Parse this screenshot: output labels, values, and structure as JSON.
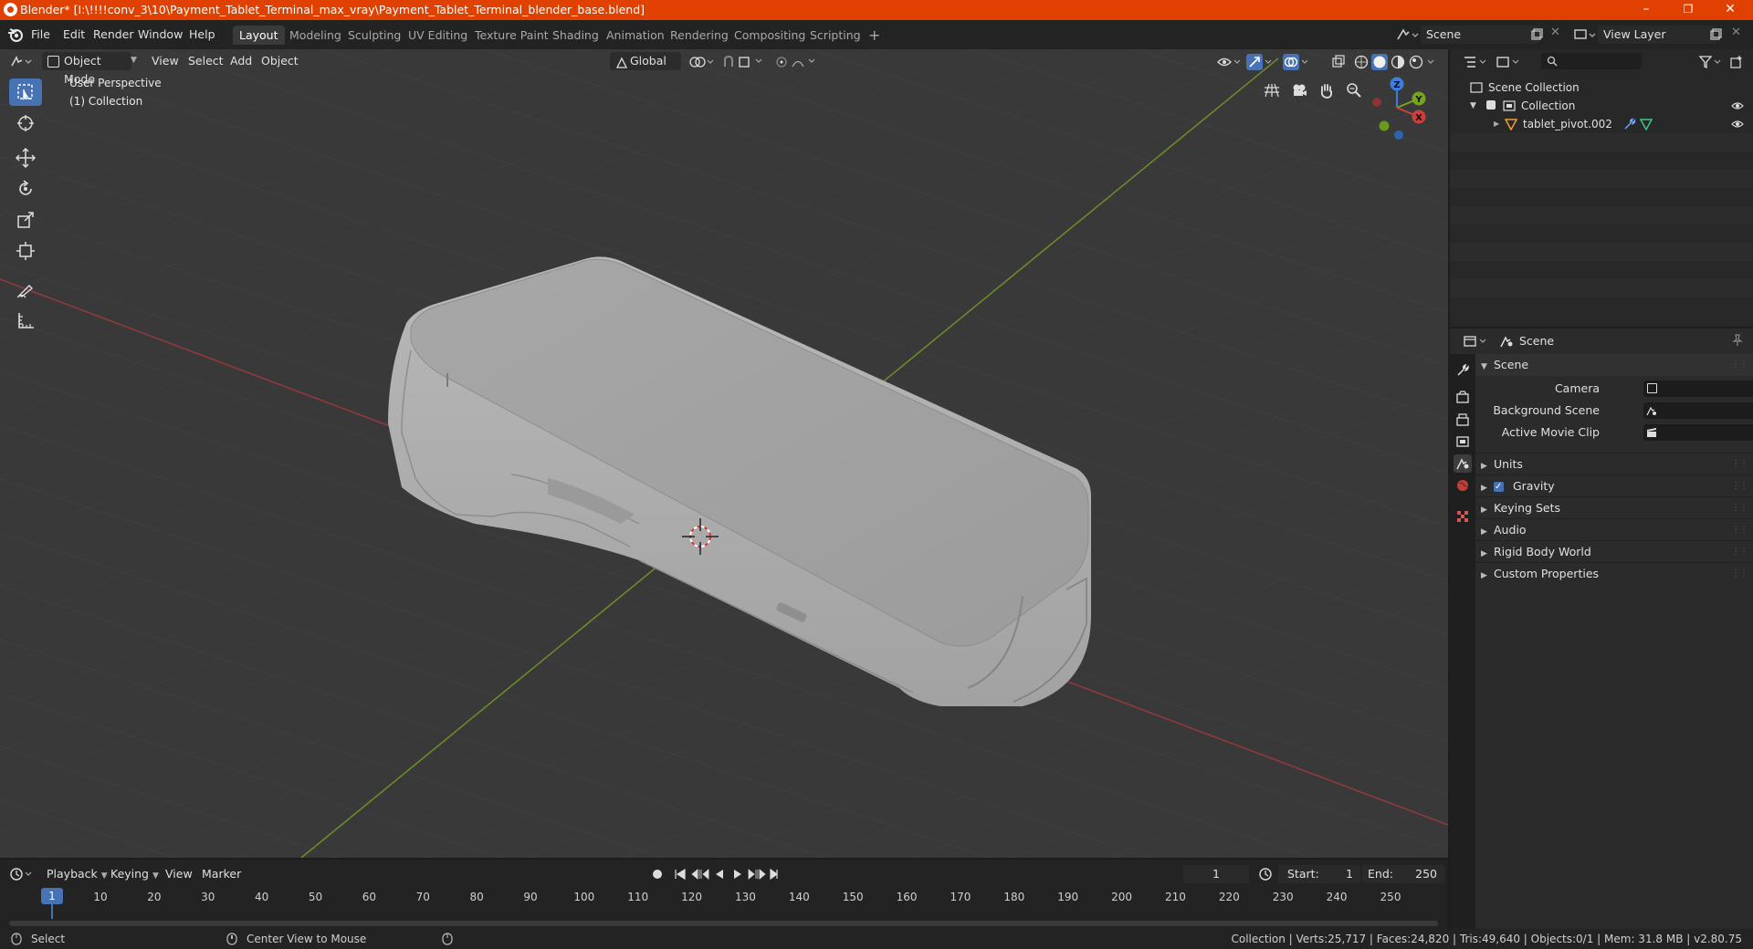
{
  "window": {
    "title": "Blender* [I:\\!!!!conv_3\\10\\Payment_Tablet_Terminal_max_vray\\Payment_Tablet_Terminal_blender_base.blend]",
    "minimize": "–",
    "maximize": "❐",
    "close": "✕"
  },
  "menubar": {
    "items": [
      "File",
      "Edit",
      "Render",
      "Window",
      "Help"
    ],
    "workspaces": [
      "Layout",
      "Modeling",
      "Sculpting",
      "UV Editing",
      "Texture Paint",
      "Shading",
      "Animation",
      "Rendering",
      "Compositing",
      "Scripting"
    ],
    "add_workspace": "+",
    "scene_label": "Scene",
    "viewlayer_label": "View Layer"
  },
  "viewport": {
    "mode": "Object Mode",
    "menus": [
      "View",
      "Select",
      "Add",
      "Object"
    ],
    "orientation": "Global",
    "perspective_text": "User Perspective",
    "collection_text": "(1) Collection",
    "gizmo": {
      "x": "X",
      "y": "Y",
      "z": "Z"
    },
    "colors": {
      "x_axis": "#c8413f",
      "y_axis": "#7aa222",
      "z_axis": "#3c7ee0",
      "accent": "#4772b3"
    }
  },
  "outliner": {
    "search_placeholder": "",
    "root": "Scene Collection",
    "collection": "Collection",
    "object": "tablet_pivot.002"
  },
  "properties": {
    "context": "Scene",
    "panel_title": "Scene",
    "camera_label": "Camera",
    "background_scene_label": "Background Scene",
    "active_clip_label": "Active Movie Clip",
    "sections": [
      "Units",
      "Gravity",
      "Keying Sets",
      "Audio",
      "Rigid Body World",
      "Custom Properties"
    ]
  },
  "timeline": {
    "menus": [
      "Playback",
      "Keying",
      "View",
      "Marker"
    ],
    "current_frame": "1",
    "start_label": "Start:",
    "start_value": "1",
    "end_label": "End:",
    "end_value": "250",
    "ticks": [
      "1",
      "10",
      "20",
      "30",
      "40",
      "50",
      "60",
      "70",
      "80",
      "90",
      "100",
      "110",
      "120",
      "130",
      "140",
      "150",
      "160",
      "170",
      "180",
      "190",
      "200",
      "210",
      "220",
      "230",
      "240",
      "250"
    ]
  },
  "statusbar": {
    "select": "Select",
    "center_view": "Center View to Mouse",
    "stats": "Collection | Verts:25,717 | Faces:24,820 | Tris:49,640 | Objects:0/1 | Mem: 31.8 MB | v2.80.75"
  }
}
